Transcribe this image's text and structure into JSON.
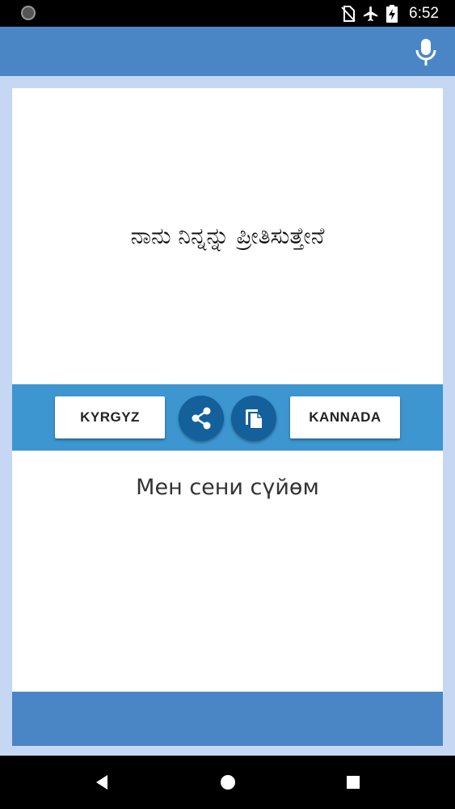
{
  "status_bar": {
    "time": "6:52",
    "icons": [
      "no-sim-icon",
      "airplane-mode-icon",
      "battery-charging-icon"
    ]
  },
  "app_bar": {
    "action_icon": "microphone-icon"
  },
  "translation": {
    "source_text": "ನಾನು ನಿನ್ನನ್ನು ಪ್ರೀತಿಸುತ್ತೇನೆ",
    "target_text": "Мен сени сүйөм"
  },
  "toolbar": {
    "left_language": "KYRGYZ",
    "right_language": "KANNADA",
    "share_icon": "share-icon",
    "copy_icon": "copy-icon"
  },
  "nav_bar": {
    "icons": [
      "back-icon",
      "home-icon",
      "recents-icon"
    ]
  },
  "colors": {
    "app_bar": "#4a86c6",
    "background": "#c5d7f3",
    "toolbar": "#3d96d0",
    "circle_button": "#14609b"
  }
}
